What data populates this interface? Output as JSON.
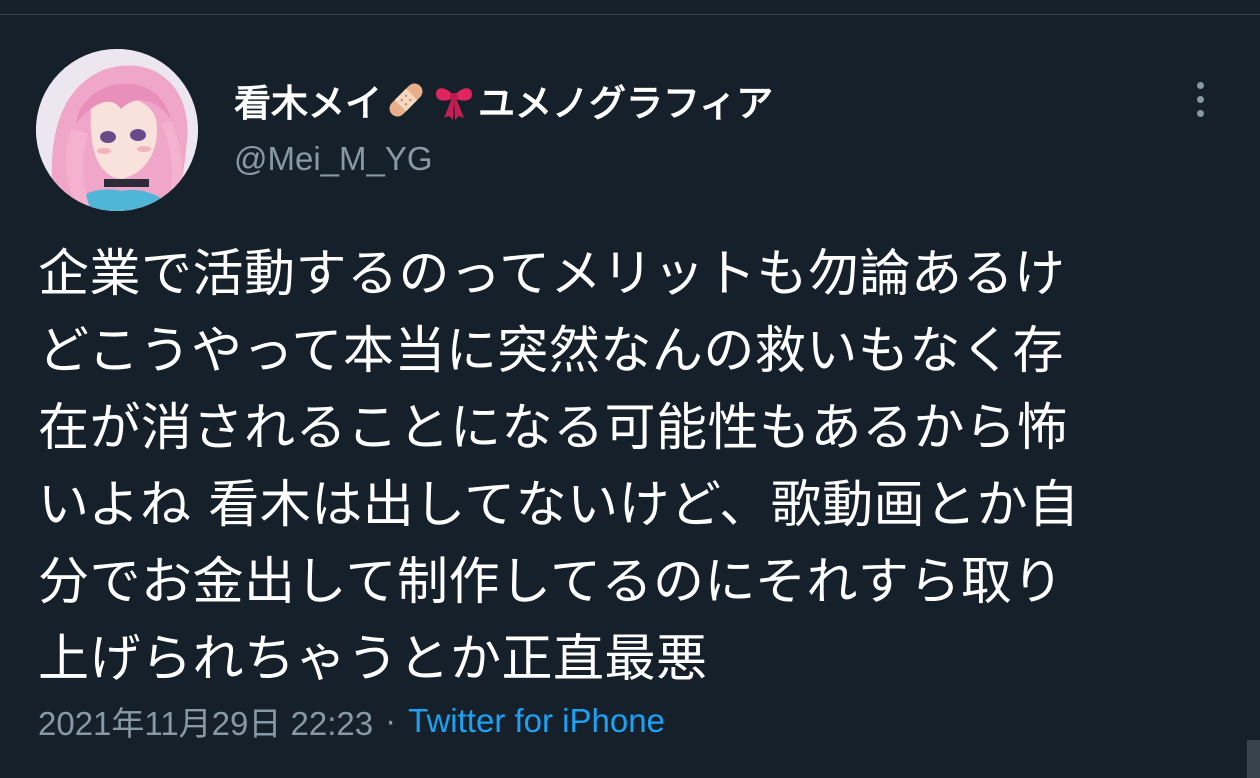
{
  "user": {
    "display_name_main": "看木メイ",
    "display_name_suffix": "ユメノグラフィア",
    "emoji_1": "adhesive-bandage-icon",
    "emoji_2": "ribbon-icon",
    "handle": "@Mei_M_YG"
  },
  "tweet": {
    "text": "企業で活動するのってメリットも勿論あるけ\nどこうやって本当に突然なんの救いもなく存\n在が消されることになる可能性もあるから怖\nいよね 看木は出してないけど、歌動画とか自\n分でお金出して制作してるのにそれすら取り\n上げられちゃうとか正直最悪",
    "timestamp": "2021年11月29日 22:23",
    "separator": "·",
    "source": "Twitter for iPhone"
  },
  "colors": {
    "background": "#15202b",
    "text_primary": "#ffffff",
    "text_secondary": "#8899a6",
    "accent": "#1da1f2"
  }
}
